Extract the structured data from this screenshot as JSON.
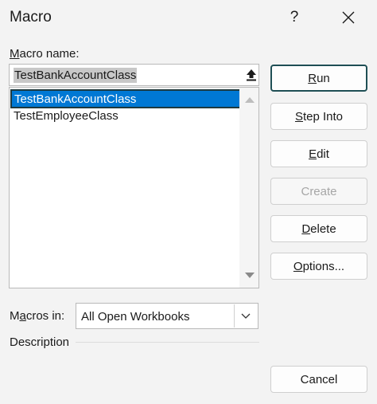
{
  "window": {
    "title": "Macro",
    "help_label": "?",
    "close_icon": "close-icon"
  },
  "macro_name": {
    "label_first": "M",
    "label_rest": "acro name:",
    "value": "TestBankAccountClass"
  },
  "macro_list": {
    "items": [
      {
        "label": "TestBankAccountClass",
        "selected": true
      },
      {
        "label": "TestEmployeeClass",
        "selected": false
      }
    ]
  },
  "buttons": {
    "run": {
      "pre": "",
      "u": "R",
      "post": "un"
    },
    "step_into": {
      "pre": "",
      "u": "S",
      "post": "tep Into"
    },
    "edit": {
      "pre": "",
      "u": "E",
      "post": "dit"
    },
    "create": {
      "label": "Create",
      "disabled": true
    },
    "delete": {
      "pre": "",
      "u": "D",
      "post": "elete"
    },
    "options": {
      "pre": "",
      "u": "O",
      "post": "ptions..."
    },
    "cancel": {
      "label": "Cancel"
    }
  },
  "macros_in": {
    "label_pre": "M",
    "label_u": "a",
    "label_post": "cros in:",
    "value": "All Open Workbooks"
  },
  "description": {
    "label": "Description"
  },
  "colors": {
    "selection": "#0078d4",
    "default_border": "#1f4f55",
    "background": "#f3f3f3"
  }
}
